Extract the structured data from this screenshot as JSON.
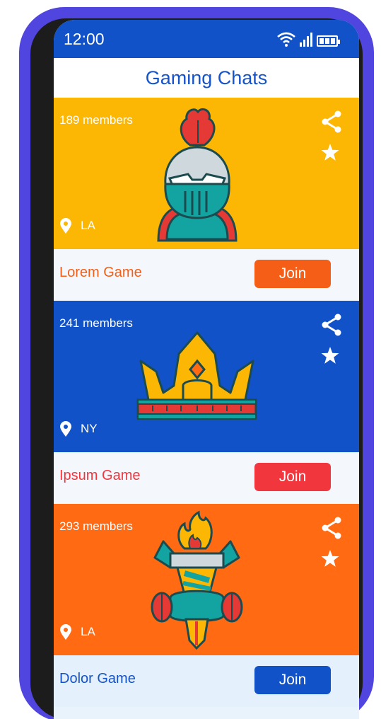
{
  "status_bar": {
    "time": "12:00",
    "icons": [
      "wifi-icon",
      "signal-icon",
      "battery-icon"
    ]
  },
  "header": {
    "title": "Gaming Chats"
  },
  "colors": {
    "frame": "#5145e0",
    "blue": "#1152c8",
    "yellow": "#fcb705",
    "orange": "#ff6a13",
    "join_orange": "#f55e16",
    "join_red": "#f2363e",
    "footer_bg": "#eef6fc"
  },
  "cards": [
    {
      "members": "189 members",
      "location": "LA",
      "game": "Lorem Game",
      "join_label": "Join",
      "art": "knight-helmet-icon",
      "icons": [
        "share-icon",
        "star-icon",
        "location-pin-icon"
      ]
    },
    {
      "members": "241 members",
      "location": "NY",
      "game": "Ipsum Game",
      "join_label": "Join",
      "art": "crown-icon",
      "icons": [
        "share-icon",
        "star-icon",
        "location-pin-icon"
      ]
    },
    {
      "members": "293 members",
      "location": "LA",
      "game": "Dolor Game",
      "join_label": "Join",
      "art": "torch-icon",
      "icons": [
        "share-icon",
        "star-icon",
        "location-pin-icon"
      ]
    }
  ]
}
